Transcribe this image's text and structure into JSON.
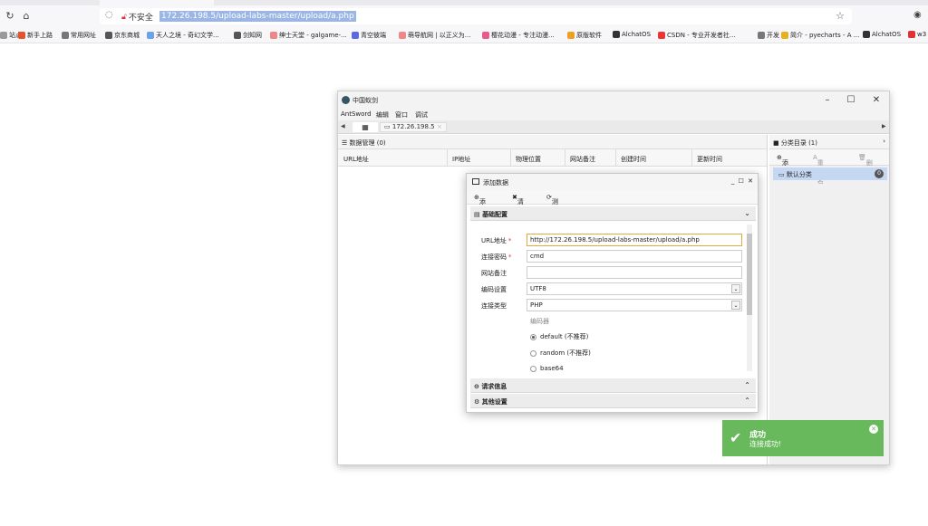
{
  "browser": {
    "address": {
      "security_label": "不安全",
      "url": "172.26.198.5/upload-labs-master/upload/a.php"
    },
    "bookmarks": [
      {
        "label": "站点",
        "color": "#999"
      },
      {
        "label": "新手上路",
        "color": "#e4532f"
      },
      {
        "label": "常用网址",
        "color": "#777"
      },
      {
        "label": "京东商城",
        "color": "#555"
      },
      {
        "label": "天人之境 - 奇幻文学...",
        "color": "#6aa3e8"
      },
      {
        "label": "剑知网",
        "color": "#555"
      },
      {
        "label": "绅士天堂 - galgame-...",
        "color": "#e88"
      },
      {
        "label": "青空彼端",
        "color": "#5a6be0"
      },
      {
        "label": "萌导航网 | 以正义为...",
        "color": "#e88"
      },
      {
        "label": "樱花动漫 - 专注动漫...",
        "color": "#e85a8a"
      },
      {
        "label": "原版软件",
        "color": "#f0a020"
      },
      {
        "label": "AlchatOS",
        "color": "#333"
      },
      {
        "label": "CSDN - 专业开发者社...",
        "color": "#e33"
      },
      {
        "label": "开发",
        "color": "#777"
      },
      {
        "label": "简介 - pyecharts - A ...",
        "color": "#e8b020"
      },
      {
        "label": "AlchatOS",
        "color": "#333"
      },
      {
        "label": "w3",
        "color": "#d33"
      }
    ]
  },
  "app": {
    "title": "中国蚁剑",
    "menu": [
      "AntSword",
      "编辑",
      "窗口",
      "调试"
    ],
    "host_tab": "172.26.198.5",
    "left_pane": {
      "title": "数据管理 (0)",
      "columns": [
        "URL地址",
        "IP地址",
        "物理位置",
        "网站备注",
        "创建时间",
        "更新时间"
      ]
    },
    "right_pane": {
      "title": "分类目录 (1)",
      "tools": [
        "添加",
        "重命名",
        "删除"
      ],
      "category": "默认分类",
      "category_count": "0"
    }
  },
  "dialog": {
    "title": "添加数据",
    "tools": [
      "添加",
      "清空",
      "测试连接"
    ],
    "sections": {
      "basic": "基础配置",
      "request": "请求信息",
      "other": "其他设置"
    },
    "fields": {
      "url_label": "URL地址",
      "url_value": "http://172.26.198.5/upload-labs-master/upload/a.php",
      "pass_label": "连接密码",
      "pass_value": "cmd",
      "note_label": "网站备注",
      "note_value": "",
      "encoding_label": "编码设置",
      "encoding_value": "UTF8",
      "type_label": "连接类型",
      "type_value": "PHP"
    },
    "encoder_label": "编码器",
    "encoders": [
      {
        "label": "default (不推荐)",
        "selected": true
      },
      {
        "label": "random (不推荐)",
        "selected": false
      },
      {
        "label": "base64",
        "selected": false
      }
    ]
  },
  "toast": {
    "title": "成功",
    "message": "连接成功!",
    "color": "#67b95c"
  }
}
